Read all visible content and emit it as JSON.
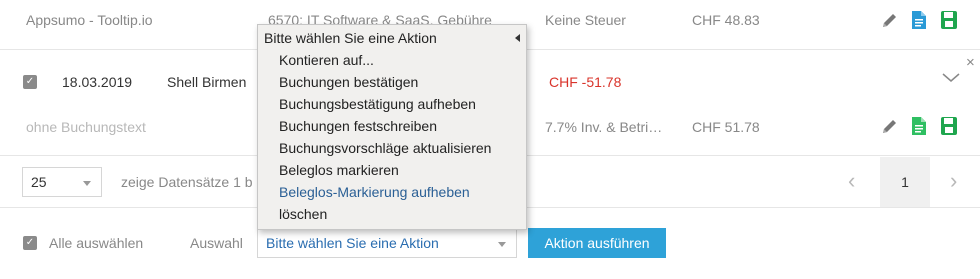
{
  "top_row": {
    "vendor": "Appsumo - Tooltip.io",
    "account": "6570: IT Software & SaaS, Gebühre",
    "tax": "Keine Steuer",
    "amount": "CHF 48.83"
  },
  "main_row": {
    "checkbox_mark": "✓",
    "date": "18.03.2019",
    "vendor": "Shell Birmen",
    "amount": "CHF -51.78",
    "sub_text": "ohne Buchungstext",
    "sub_tax": "7.7% Inv. & Betri…",
    "sub_amount": "CHF 51.78",
    "close_label": "×"
  },
  "pager": {
    "page_size": "25",
    "info": "zeige Datensätze 1 b",
    "prev": "‹",
    "current": "1",
    "next": "›"
  },
  "bottom": {
    "checkbox_mark": "✓",
    "select_all": "Alle auswählen",
    "selection_label": "Auswahl",
    "action_select": "Bitte wählen Sie eine Aktion",
    "execute": "Aktion ausführen"
  },
  "menu": {
    "header": "Bitte wählen Sie eine Aktion",
    "items": [
      "Kontieren auf...",
      "Buchungen bestätigen",
      "Buchungsbestätigung aufheben",
      "Buchungen festschreiben",
      "Buchungsvorschläge aktualisieren",
      "Beleglos markieren",
      "Beleglos-Markierung aufheben",
      "löschen"
    ],
    "highlighted_index": 6
  },
  "colors": {
    "accent": "#2ea2d8",
    "negative": "#d9342b",
    "doc_blue": "#2a9ad6",
    "doc_green": "#2fbf62",
    "save_green": "#1fa64e"
  },
  "icons": [
    "pencil-icon",
    "document-icon",
    "save-icon",
    "chevron-down-icon",
    "close-icon"
  ]
}
